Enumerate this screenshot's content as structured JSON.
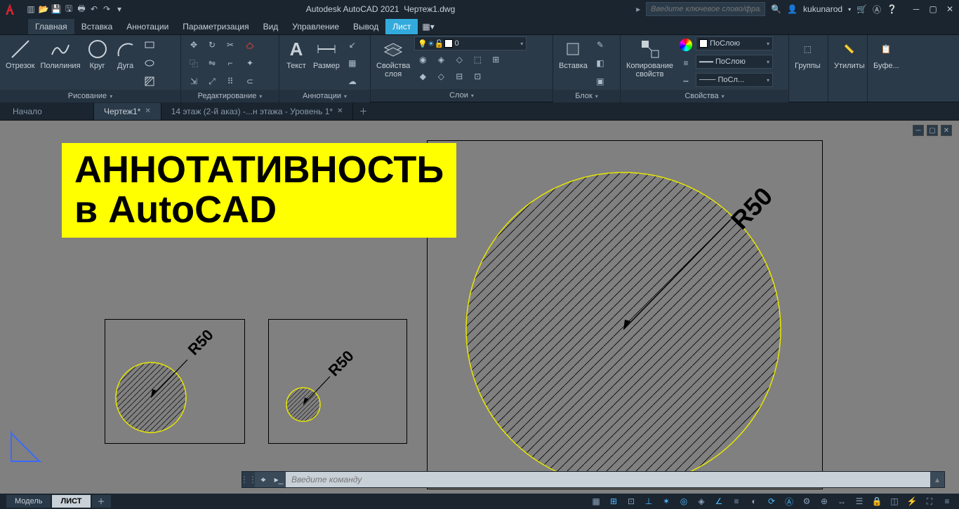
{
  "title": {
    "app": "Autodesk AutoCAD 2021",
    "file": "Чертеж1.dwg"
  },
  "search": {
    "placeholder": "Введите ключевое слово/фразу"
  },
  "user": {
    "name": "kukunarod"
  },
  "menu": {
    "tabs": [
      "Главная",
      "Вставка",
      "Аннотации",
      "Параметризация",
      "Вид",
      "Управление",
      "Вывод",
      "Лист"
    ],
    "active": 7
  },
  "ribbon": {
    "draw": {
      "title": "Рисование",
      "line": "Отрезок",
      "pline": "Полилиния",
      "circle": "Круг",
      "arc": "Дуга"
    },
    "modify": {
      "title": "Редактирование"
    },
    "annot": {
      "title": "Аннотации",
      "text": "Текст",
      "dim": "Размер"
    },
    "layers": {
      "title": "Слои",
      "props": "Свойства\nслоя",
      "current": "0"
    },
    "block": {
      "title": "Блок",
      "insert": "Вставка"
    },
    "props": {
      "title": "Свойства",
      "match": "Копирование\nсвойств",
      "bylayer": "ПоСлою",
      "bylayer2": "ПоСлою",
      "bylayer3": "ПоСл..."
    },
    "groups": {
      "title": "",
      "label": "Группы"
    },
    "utils": {
      "title": "",
      "label": "Утилиты"
    },
    "clip": {
      "title": "",
      "label": "Буфе..."
    }
  },
  "doctabs": {
    "start": "Начало",
    "items": [
      "Чертеж1*",
      "14 этаж (2-й аказ) -...н этажа - Уровень 1*"
    ],
    "active": 0
  },
  "overlay": {
    "line1": "АННОТАТИВНОСТЬ",
    "line2": "в AutoCAD"
  },
  "dims": {
    "r1": "R50",
    "r2": "R50",
    "r3": "R50"
  },
  "cmd": {
    "placeholder": "Введите команду"
  },
  "layout": {
    "model": "Модель",
    "sheet": "ЛИСТ"
  }
}
